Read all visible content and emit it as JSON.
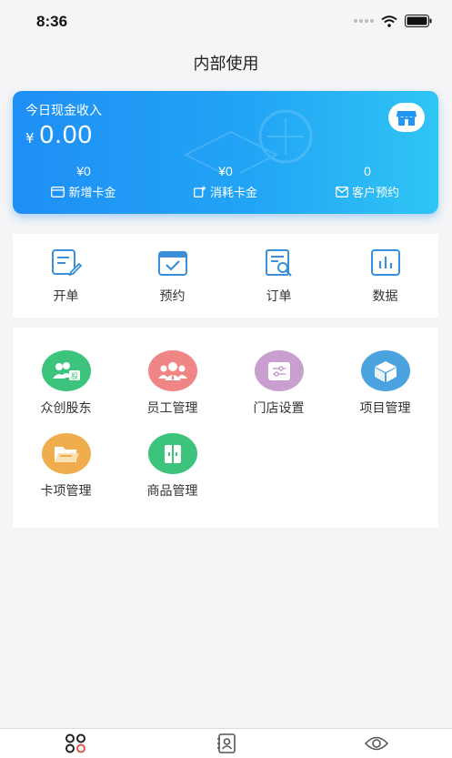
{
  "status_bar": {
    "time": "8:36"
  },
  "nav": {
    "title": "内部使用"
  },
  "cash_card": {
    "label": "今日现金收入",
    "currency": "¥",
    "amount": "0.00",
    "stats": [
      {
        "value": "¥0",
        "label": "新增卡金",
        "icon": "card-icon"
      },
      {
        "value": "¥0",
        "label": "消耗卡金",
        "icon": "consume-icon"
      },
      {
        "value": "0",
        "label": "客户预约",
        "icon": "mail-icon"
      }
    ]
  },
  "quick_actions": [
    {
      "label": "开单",
      "icon": "edit-note-icon"
    },
    {
      "label": "预约",
      "icon": "calendar-check-icon"
    },
    {
      "label": "订单",
      "icon": "order-search-icon"
    },
    {
      "label": "数据",
      "icon": "bar-chart-icon"
    }
  ],
  "functions": [
    {
      "label": "众创股东",
      "icon": "shareholder-icon",
      "color": "#3cc47c"
    },
    {
      "label": "员工管理",
      "icon": "staff-icon",
      "color": "#ef8585"
    },
    {
      "label": "门店设置",
      "icon": "settings-sliders-icon",
      "color": "#c99fd0"
    },
    {
      "label": "项目管理",
      "icon": "box-icon",
      "color": "#4aa3df"
    },
    {
      "label": "卡项管理",
      "icon": "folder-icon",
      "color": "#f0ad4e"
    },
    {
      "label": "商品管理",
      "icon": "goods-icon",
      "color": "#3cc47c"
    }
  ],
  "tab_bar": [
    {
      "icon": "home-grid-icon"
    },
    {
      "icon": "contacts-icon"
    },
    {
      "icon": "eye-icon"
    }
  ],
  "colors": {
    "accent": "#2196f3",
    "card_start": "#1e8ff5",
    "card_end": "#2fc5f4"
  }
}
